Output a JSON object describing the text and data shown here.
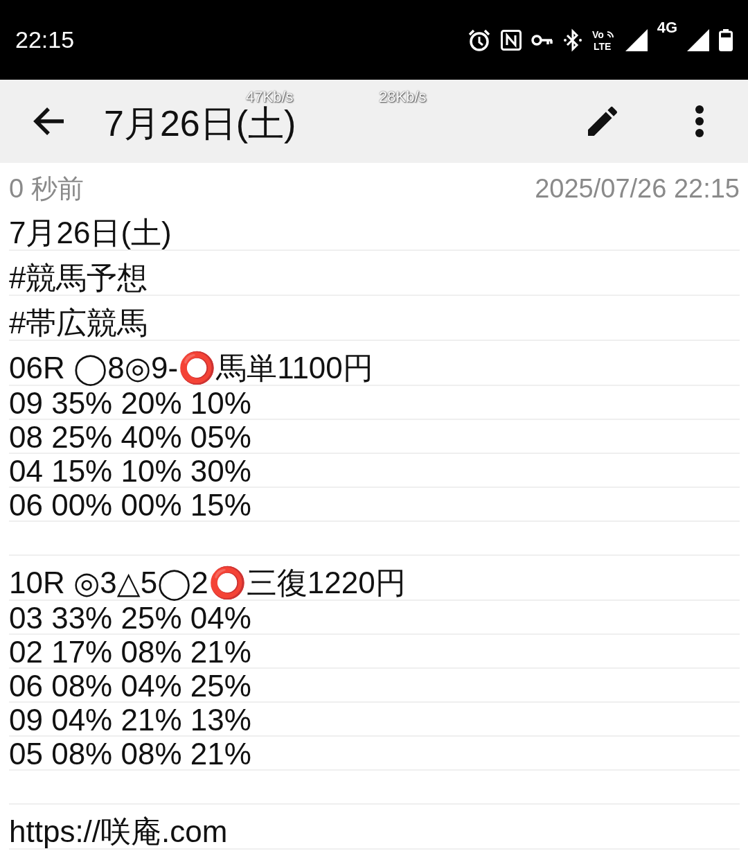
{
  "status_bar": {
    "time": "22:15",
    "network_label": "4G",
    "volte_label": [
      "Vo",
      "LTE"
    ]
  },
  "speed_overlay": [
    "47Kb/s",
    "28Kb/s"
  ],
  "toolbar": {
    "title": "7月26日(土)"
  },
  "note": {
    "relative_time": "0 秒前",
    "timestamp": "2025/07/26 22:15",
    "lines": [
      {
        "kind": "text",
        "text": "7月26日(土)"
      },
      {
        "kind": "text",
        "text": "#競馬予想"
      },
      {
        "kind": "text",
        "text": "#帯広競馬"
      },
      {
        "kind": "text",
        "text": "06R ◯8◎9-⭕馬単1100円"
      },
      {
        "kind": "figures",
        "text": "09 35% 20% 10%"
      },
      {
        "kind": "figures",
        "text": "08 25% 40% 05%"
      },
      {
        "kind": "figures",
        "text": "04 15% 10% 30%"
      },
      {
        "kind": "figures",
        "text": "06 00% 00% 15%"
      },
      {
        "kind": "blank"
      },
      {
        "kind": "text",
        "text": "10R ◎3△5◯2⭕三復1220円"
      },
      {
        "kind": "figures",
        "text": "03 33% 25% 04%"
      },
      {
        "kind": "figures",
        "text": "02 17% 08% 21%"
      },
      {
        "kind": "figures",
        "text": "06 08% 04% 25%"
      },
      {
        "kind": "figures",
        "text": "09 04% 21% 13%"
      },
      {
        "kind": "figures",
        "text": "05 08% 08% 21%"
      },
      {
        "kind": "blank"
      },
      {
        "kind": "link",
        "text": "https://咲庵.com"
      }
    ]
  }
}
